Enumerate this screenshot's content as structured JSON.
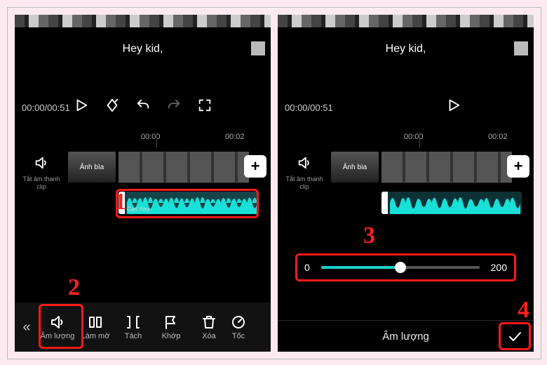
{
  "annotations": {
    "a1": "1",
    "a2": "2",
    "a3": "3",
    "a4": "4"
  },
  "left": {
    "preview_caption": "Hey kid,",
    "time_display": "00:00/00:51",
    "ruler": {
      "t1": "00:00",
      "t2": "00:02"
    },
    "mute": {
      "label": "Tắt âm thanh clip"
    },
    "cover_label": "Ảnh bìa",
    "audio_name": "Get You",
    "tools": {
      "volume": "Âm lượng",
      "fade": "Làm mờ",
      "split": "Tách",
      "beat": "Khớp",
      "delete": "Xóa",
      "speed": "Tốc"
    }
  },
  "right": {
    "preview_caption": "Hey kid,",
    "time_display": "00:00/00:51",
    "ruler": {
      "t1": "00:00",
      "t2": "00:02"
    },
    "mute": {
      "label": "Tắt âm thanh clip"
    },
    "cover_label": "Ảnh bìa",
    "slider": {
      "min": "0",
      "max": "200"
    },
    "panel_title": "Âm lượng"
  }
}
